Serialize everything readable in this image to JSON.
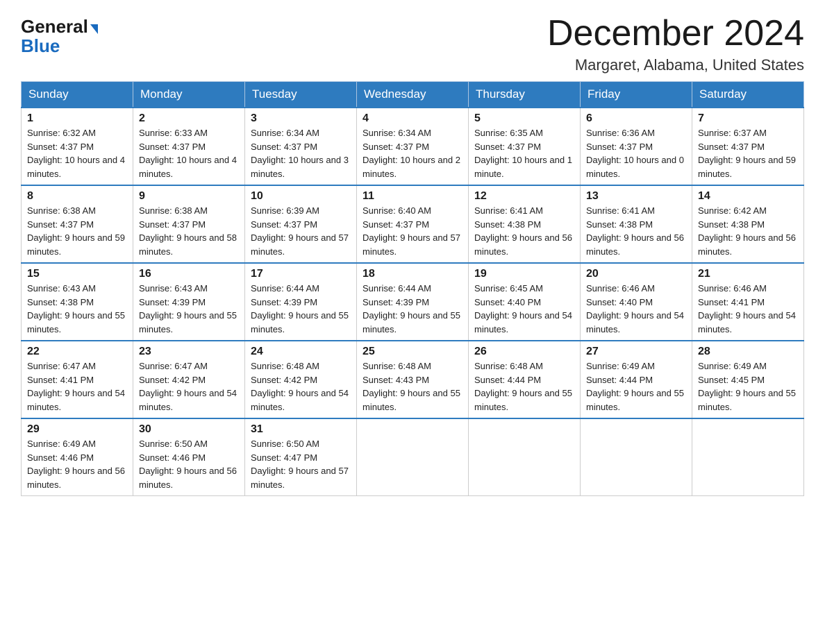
{
  "header": {
    "logo_general": "General",
    "logo_blue": "Blue",
    "month_title": "December 2024",
    "location": "Margaret, Alabama, United States"
  },
  "days_of_week": [
    "Sunday",
    "Monday",
    "Tuesday",
    "Wednesday",
    "Thursday",
    "Friday",
    "Saturday"
  ],
  "weeks": [
    [
      {
        "day": "1",
        "sunrise": "6:32 AM",
        "sunset": "4:37 PM",
        "daylight": "10 hours and 4 minutes."
      },
      {
        "day": "2",
        "sunrise": "6:33 AM",
        "sunset": "4:37 PM",
        "daylight": "10 hours and 4 minutes."
      },
      {
        "day": "3",
        "sunrise": "6:34 AM",
        "sunset": "4:37 PM",
        "daylight": "10 hours and 3 minutes."
      },
      {
        "day": "4",
        "sunrise": "6:34 AM",
        "sunset": "4:37 PM",
        "daylight": "10 hours and 2 minutes."
      },
      {
        "day": "5",
        "sunrise": "6:35 AM",
        "sunset": "4:37 PM",
        "daylight": "10 hours and 1 minute."
      },
      {
        "day": "6",
        "sunrise": "6:36 AM",
        "sunset": "4:37 PM",
        "daylight": "10 hours and 0 minutes."
      },
      {
        "day": "7",
        "sunrise": "6:37 AM",
        "sunset": "4:37 PM",
        "daylight": "9 hours and 59 minutes."
      }
    ],
    [
      {
        "day": "8",
        "sunrise": "6:38 AM",
        "sunset": "4:37 PM",
        "daylight": "9 hours and 59 minutes."
      },
      {
        "day": "9",
        "sunrise": "6:38 AM",
        "sunset": "4:37 PM",
        "daylight": "9 hours and 58 minutes."
      },
      {
        "day": "10",
        "sunrise": "6:39 AM",
        "sunset": "4:37 PM",
        "daylight": "9 hours and 57 minutes."
      },
      {
        "day": "11",
        "sunrise": "6:40 AM",
        "sunset": "4:37 PM",
        "daylight": "9 hours and 57 minutes."
      },
      {
        "day": "12",
        "sunrise": "6:41 AM",
        "sunset": "4:38 PM",
        "daylight": "9 hours and 56 minutes."
      },
      {
        "day": "13",
        "sunrise": "6:41 AM",
        "sunset": "4:38 PM",
        "daylight": "9 hours and 56 minutes."
      },
      {
        "day": "14",
        "sunrise": "6:42 AM",
        "sunset": "4:38 PM",
        "daylight": "9 hours and 56 minutes."
      }
    ],
    [
      {
        "day": "15",
        "sunrise": "6:43 AM",
        "sunset": "4:38 PM",
        "daylight": "9 hours and 55 minutes."
      },
      {
        "day": "16",
        "sunrise": "6:43 AM",
        "sunset": "4:39 PM",
        "daylight": "9 hours and 55 minutes."
      },
      {
        "day": "17",
        "sunrise": "6:44 AM",
        "sunset": "4:39 PM",
        "daylight": "9 hours and 55 minutes."
      },
      {
        "day": "18",
        "sunrise": "6:44 AM",
        "sunset": "4:39 PM",
        "daylight": "9 hours and 55 minutes."
      },
      {
        "day": "19",
        "sunrise": "6:45 AM",
        "sunset": "4:40 PM",
        "daylight": "9 hours and 54 minutes."
      },
      {
        "day": "20",
        "sunrise": "6:46 AM",
        "sunset": "4:40 PM",
        "daylight": "9 hours and 54 minutes."
      },
      {
        "day": "21",
        "sunrise": "6:46 AM",
        "sunset": "4:41 PM",
        "daylight": "9 hours and 54 minutes."
      }
    ],
    [
      {
        "day": "22",
        "sunrise": "6:47 AM",
        "sunset": "4:41 PM",
        "daylight": "9 hours and 54 minutes."
      },
      {
        "day": "23",
        "sunrise": "6:47 AM",
        "sunset": "4:42 PM",
        "daylight": "9 hours and 54 minutes."
      },
      {
        "day": "24",
        "sunrise": "6:48 AM",
        "sunset": "4:42 PM",
        "daylight": "9 hours and 54 minutes."
      },
      {
        "day": "25",
        "sunrise": "6:48 AM",
        "sunset": "4:43 PM",
        "daylight": "9 hours and 55 minutes."
      },
      {
        "day": "26",
        "sunrise": "6:48 AM",
        "sunset": "4:44 PM",
        "daylight": "9 hours and 55 minutes."
      },
      {
        "day": "27",
        "sunrise": "6:49 AM",
        "sunset": "4:44 PM",
        "daylight": "9 hours and 55 minutes."
      },
      {
        "day": "28",
        "sunrise": "6:49 AM",
        "sunset": "4:45 PM",
        "daylight": "9 hours and 55 minutes."
      }
    ],
    [
      {
        "day": "29",
        "sunrise": "6:49 AM",
        "sunset": "4:46 PM",
        "daylight": "9 hours and 56 minutes."
      },
      {
        "day": "30",
        "sunrise": "6:50 AM",
        "sunset": "4:46 PM",
        "daylight": "9 hours and 56 minutes."
      },
      {
        "day": "31",
        "sunrise": "6:50 AM",
        "sunset": "4:47 PM",
        "daylight": "9 hours and 57 minutes."
      },
      null,
      null,
      null,
      null
    ]
  ]
}
